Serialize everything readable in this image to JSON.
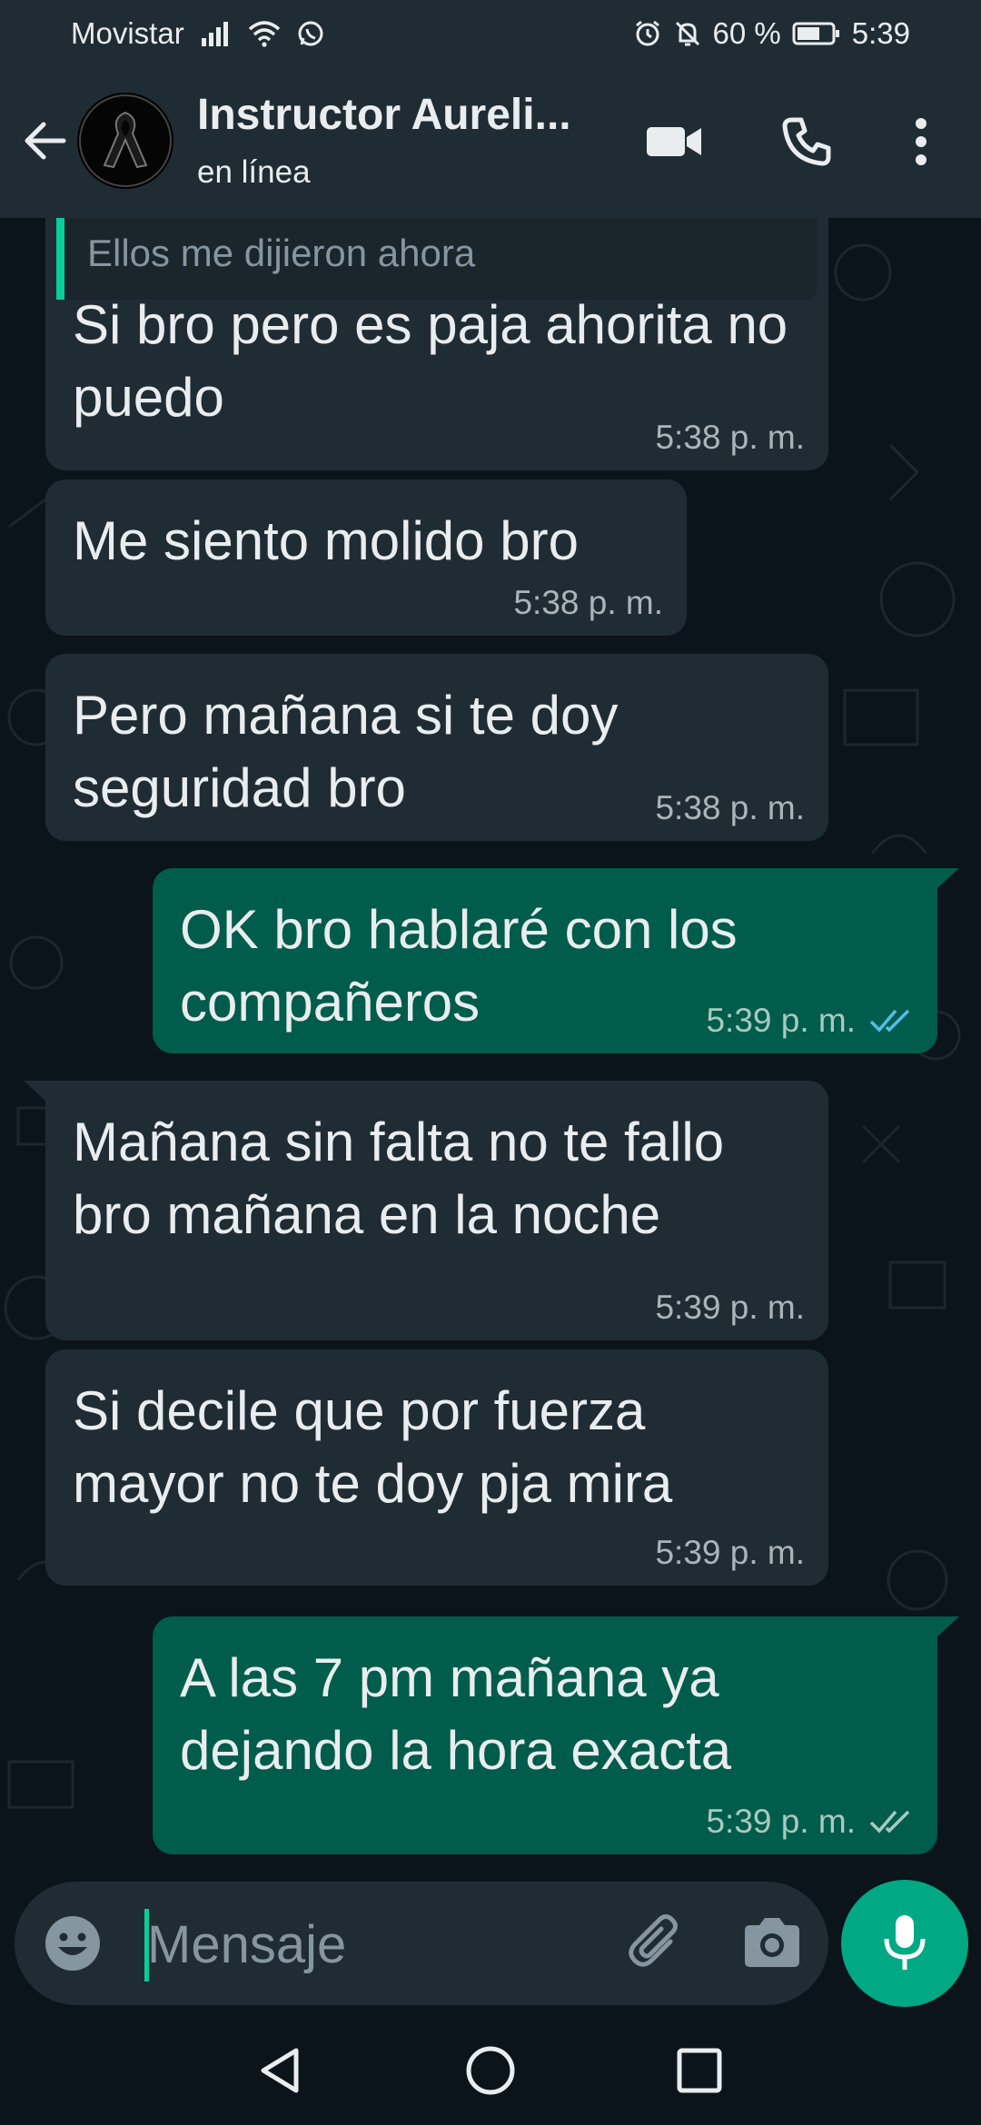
{
  "status_bar": {
    "carrier": "Movistar",
    "battery": "60 %",
    "time": "5:39",
    "icons": [
      "signal-icon",
      "wifi-icon",
      "whatsapp-icon",
      "alarm-icon",
      "mute-icon",
      "battery-icon"
    ]
  },
  "header": {
    "contact_name": "Instructor Aureli...",
    "status": "en línea",
    "icons": [
      "back-arrow-icon",
      "video-call-icon",
      "phone-icon",
      "more-options-icon"
    ]
  },
  "quoted_text": "Ellos me dijieron ahora",
  "messages": [
    {
      "direction": "in",
      "text": "Si bro pero es paja ahorita no puedo",
      "time": "5:38 p. m."
    },
    {
      "direction": "in",
      "text": "Me siento molido bro",
      "time": "5:38 p. m."
    },
    {
      "direction": "in",
      "text": "Pero mañana si te doy seguridad bro",
      "time": "5:38 p. m."
    },
    {
      "direction": "out",
      "text": "OK bro hablaré con los compañeros",
      "time": "5:39 p. m.",
      "read": true
    },
    {
      "direction": "in",
      "text": "Mañana sin falta no te fallo bro mañana en la noche",
      "time": "5:39 p. m."
    },
    {
      "direction": "in",
      "text": "Si decile que por fuerza mayor no te doy pja mira",
      "time": "5:39 p. m."
    },
    {
      "direction": "out",
      "text": "A las 7 pm mañana ya dejando la hora exacta",
      "time": "5:39 p. m.",
      "read": false
    }
  ],
  "input": {
    "placeholder": "Mensaje",
    "value": ""
  },
  "colors": {
    "background": "#0b141a",
    "bar": "#202c33",
    "incoming": "#202c33",
    "outgoing": "#005c4b",
    "accent": "#00a884",
    "read_tick": "#53bdeb",
    "sent_tick": "#a9c9c1"
  }
}
